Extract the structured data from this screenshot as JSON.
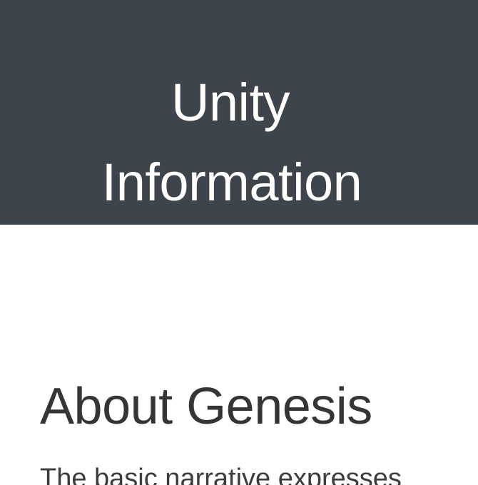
{
  "header": {
    "title_line_1": "Unity",
    "title_line_2": "Information"
  },
  "section": {
    "heading": "About Genesis",
    "body_visible": "The basic narrative expresses"
  },
  "colors": {
    "header_background": "#3e444c",
    "header_text": "#ffffff",
    "page_background": "#ffffff",
    "heading_text": "#353535",
    "body_text": "#3c3c3c"
  }
}
